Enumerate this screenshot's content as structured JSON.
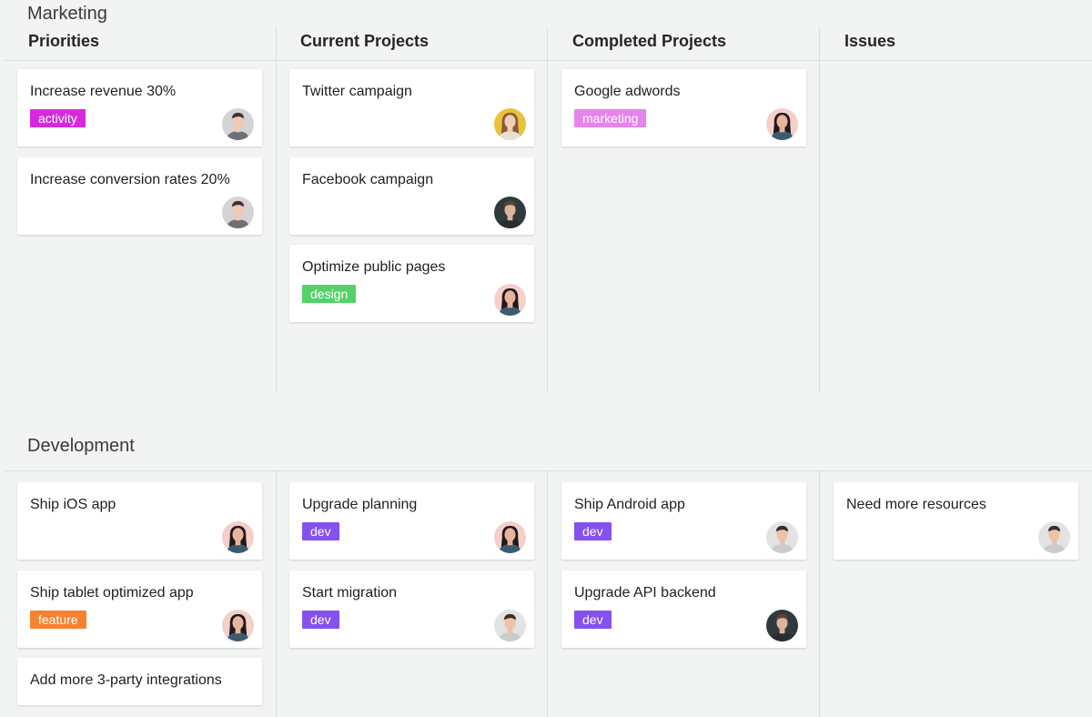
{
  "board": {
    "columns": [
      "Priorities",
      "Current Projects",
      "Completed Projects",
      "Issues"
    ],
    "swimlanes": [
      {
        "title": "Marketing",
        "columns": [
          [
            {
              "title": "Increase revenue 30%",
              "tag": "activity",
              "tag_color": "#d529dc",
              "avatar": "man-gray"
            },
            {
              "title": "Increase conversion rates 20%",
              "tag": "",
              "tag_color": "",
              "avatar": "man-gray"
            }
          ],
          [
            {
              "title": "Twitter campaign",
              "tag": "",
              "tag_color": "",
              "avatar": "woman-yellow"
            },
            {
              "title": "Facebook campaign",
              "tag": "",
              "tag_color": "",
              "avatar": "man-dark"
            },
            {
              "title": "Optimize public pages",
              "tag": "design",
              "tag_color": "#55d16a",
              "avatar": "woman-pink"
            }
          ],
          [
            {
              "title": "Google adwords",
              "tag": "marketing",
              "tag_color": "#e883ec",
              "avatar": "woman-pink"
            }
          ],
          []
        ]
      },
      {
        "title": "Development",
        "columns": [
          [
            {
              "title": "Ship iOS app",
              "tag": "",
              "tag_color": "",
              "avatar": "woman-pink"
            },
            {
              "title": "Ship tablet optimized app",
              "tag": "feature",
              "tag_color": "#f7812f",
              "avatar": "woman-pink"
            },
            {
              "title": "Add more 3-party integrations",
              "tag": "",
              "tag_color": "",
              "avatar": ""
            }
          ],
          [
            {
              "title": "Upgrade planning",
              "tag": "dev",
              "tag_color": "#8451f0",
              "avatar": "woman-pink"
            },
            {
              "title": "Start migration",
              "tag": "dev",
              "tag_color": "#8451f0",
              "avatar": "man-light"
            }
          ],
          [
            {
              "title": "Ship Android app",
              "tag": "dev",
              "tag_color": "#8451f0",
              "avatar": "man-light"
            },
            {
              "title": "Upgrade API backend",
              "tag": "dev",
              "tag_color": "#8451f0",
              "avatar": "man-dark"
            }
          ],
          [
            {
              "title": "Need more resources",
              "tag": "",
              "tag_color": "",
              "avatar": "man-light"
            }
          ]
        ]
      }
    ]
  },
  "colors": {
    "background": "#f2f3f3",
    "card": "#ffffff",
    "divider": "#dcdddd"
  }
}
